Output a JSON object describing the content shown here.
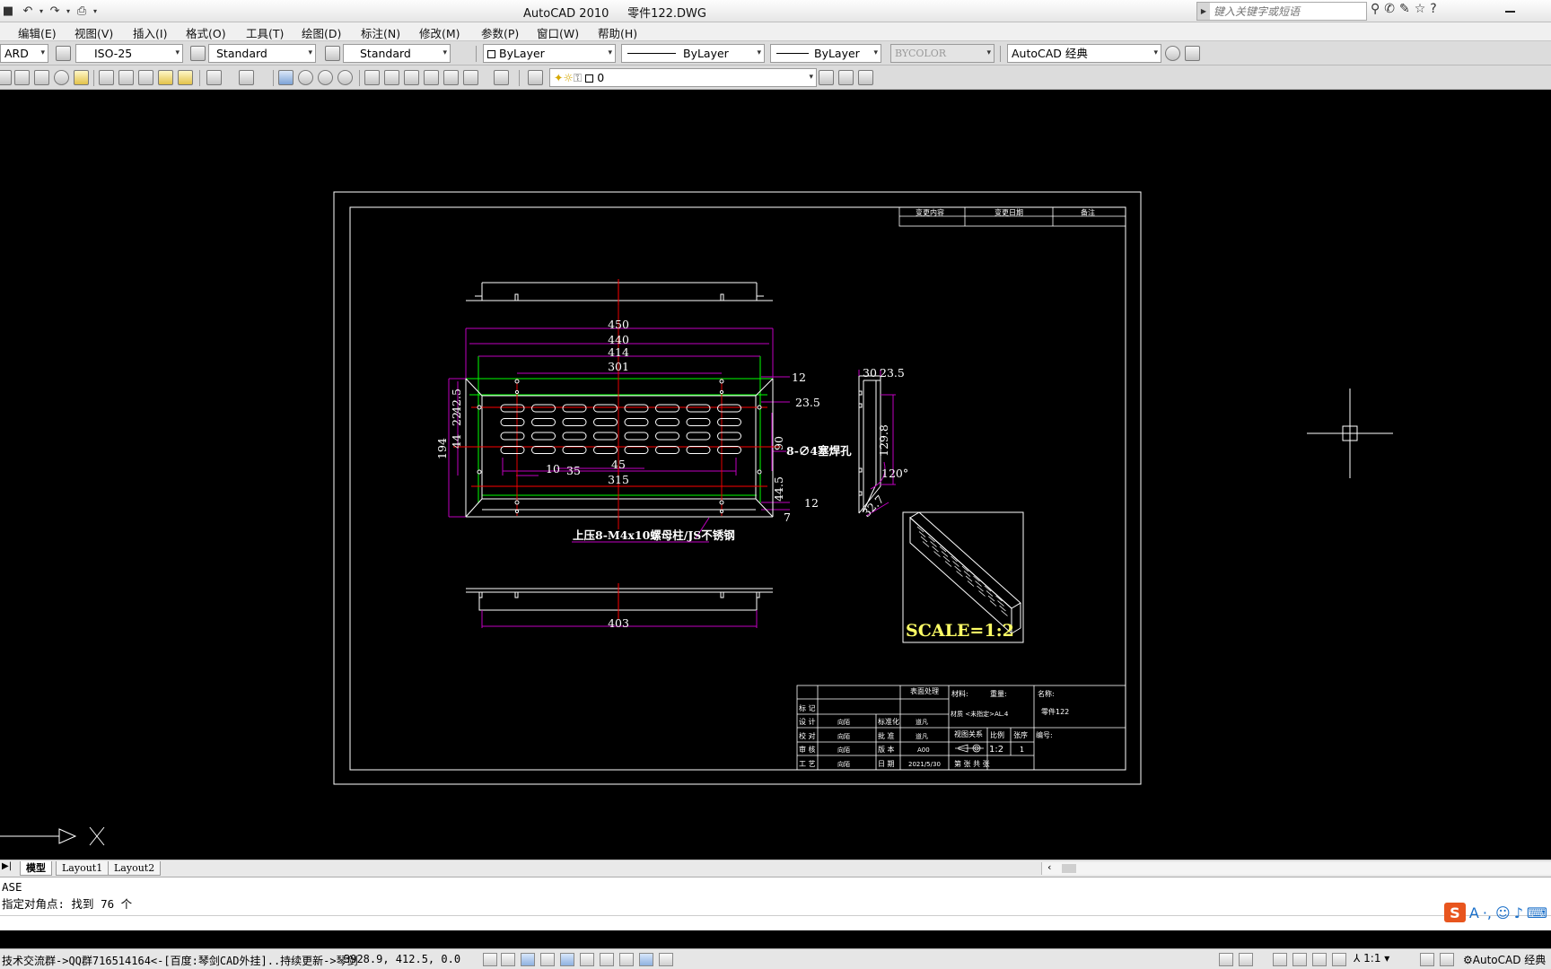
{
  "app": {
    "title": "AutoCAD 2010",
    "file_name": "零件122.DWG"
  },
  "search": {
    "placeholder": "键入关键字或短语"
  },
  "menu": [
    "编辑(E)",
    "视图(V)",
    "插入(I)",
    "格式(O)",
    "工具(T)",
    "绘图(D)",
    "标注(N)",
    "修改(M)",
    "参数(P)",
    "窗口(W)",
    "帮助(H)"
  ],
  "toolbar1": {
    "text_style_partial": "ARD",
    "dim_style": "ISO-25",
    "table_style": "Standard",
    "multileader_style": "Standard",
    "color": "ByLayer",
    "linetype": "ByLayer",
    "lineweight": "ByLayer",
    "plot_style": "BYCOLOR",
    "workspace": "AutoCAD 经典"
  },
  "toolbar2": {
    "layer": "0"
  },
  "drawing": {
    "revision_headers": [
      "变更内容",
      "变更日期",
      "备注"
    ],
    "dims": {
      "d450": "450",
      "d440": "440",
      "d414": "414",
      "d301": "301",
      "d12a": "12",
      "d23_5": "23.5",
      "d42_5": "42.5",
      "d22": "22",
      "d44": "44",
      "d194": "194",
      "d90": "90",
      "d10": "10",
      "d35": "35",
      "d45": "45",
      "d315": "315",
      "d44_5": "44.5",
      "d12b": "12",
      "d7": "7",
      "d403": "403",
      "s30": "30",
      "s23_5": "23.5",
      "s129_8": "129.8",
      "s120": "120°",
      "s32_7": "32.7"
    },
    "notes": {
      "hole_note": "8-∅4塞焊孔",
      "nut_note": "上压8-M4x10螺母柱/JS不锈钢",
      "scale_note": "SCALE=1:2"
    },
    "title_block": {
      "surface_treatment": "表面处理",
      "material_label": "材料:",
      "weight_label": "重量:",
      "name_label": "名称:",
      "name_value": "零件122",
      "material_value": "材质 <未指定>AL.4",
      "mark": "标 记",
      "design": "设 计",
      "check": "校 对",
      "review": "审 核",
      "process": "工 艺",
      "person": "向陌",
      "standard": "标准化",
      "approve": "批 准",
      "version": "版 本",
      "date_label": "日 期",
      "person2": "道凡",
      "version_value": "A00",
      "date_value": "2021/5/30",
      "view_relation": "视图关系",
      "scale_label": "比例",
      "sheet_label": "张序",
      "scale_value": "1:2",
      "sheet_value": "1",
      "part_no_label": "编号:",
      "sheet_of": "第    张    共    张"
    }
  },
  "tabs": [
    "模型",
    "Layout1",
    "Layout2"
  ],
  "command": {
    "line1": "ASE",
    "line2": "指定对角点: 找到 76 个"
  },
  "status": {
    "marquee": "技术交流群->QQ群716514164<-[百度:琴剑CAD外挂]..持续更新->琴剑",
    "coords": "3928.9, 412.5, 0.0",
    "annotation_scale": "1:1",
    "workspace": "AutoCAD 经典"
  },
  "colors": {
    "canvas": "#000000",
    "geometry": "#ffffff",
    "dimension": "#c000c0",
    "centerline": "#ff0000",
    "construction": "#00ff00",
    "note": "#ffff66"
  }
}
